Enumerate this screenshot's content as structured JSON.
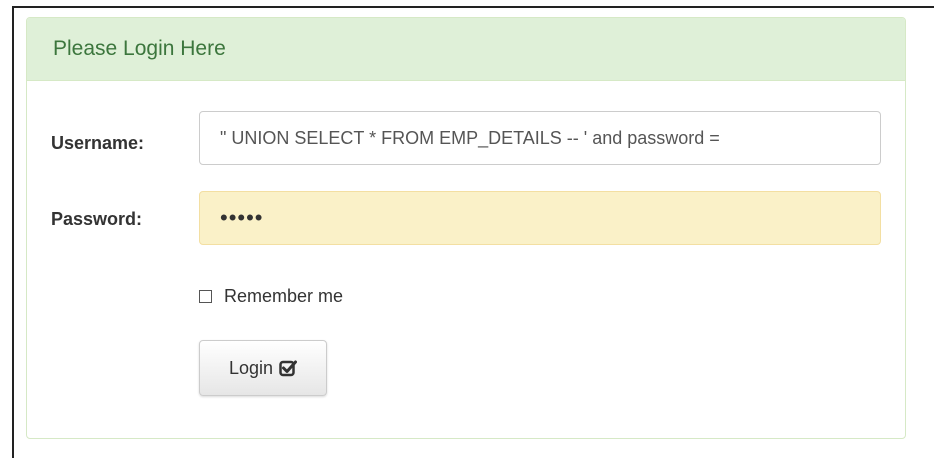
{
  "panel": {
    "title": "Please Login Here"
  },
  "form": {
    "username_label": "Username:",
    "username_value": "\" UNION SELECT * FROM EMP_DETAILS -- ' and password =",
    "password_label": "Password:",
    "password_value": "•••••",
    "remember_label": "Remember me",
    "remember_checked": false,
    "login_label": "Login",
    "login_icon": "check-square-icon"
  },
  "colors": {
    "heading_bg": "#dff0d8",
    "heading_text": "#3c763d",
    "password_bg": "#faf1c8"
  }
}
